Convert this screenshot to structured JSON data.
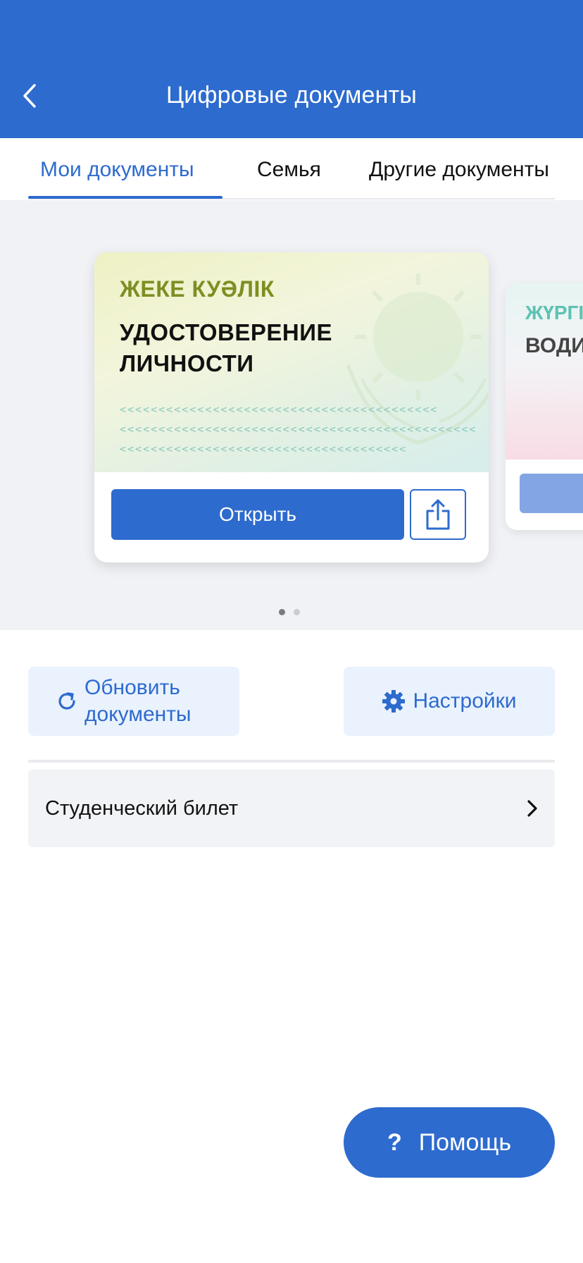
{
  "header": {
    "title": "Цифровые документы",
    "back_icon": "chevron-left-icon"
  },
  "tabs": [
    {
      "label": "Мои документы",
      "active": true
    },
    {
      "label": "Семья",
      "active": false
    },
    {
      "label": "Другие документы",
      "active": false
    }
  ],
  "carousel": {
    "cards": [
      {
        "title_kz": "ЖЕКЕ КУӘЛІК",
        "title_ru": "УДОСТОВЕРЕНИЕ ЛИЧНОСТИ",
        "mrz": [
          "<<<<<<<<<<<<<<<<<<<<<<<<<<<<<<<<<<<<<<<<<",
          "<<<<<<<<<<<<<<<<<<<<<<<<<<<<<<<<<<<<<<<<<<<<<<",
          "<<<<<<<<<<<<<<<<<<<<<<<<<<<<<<<<<<<<<"
        ],
        "open_label": "Открыть",
        "share_icon": "share-icon"
      },
      {
        "title_kz": "ЖҮРГІ",
        "title_ru": "ВОДИТ"
      }
    ],
    "page_count": 2,
    "current_page": 1
  },
  "actions": {
    "refresh_label_line1": "Обновить",
    "refresh_label_line2": "документы",
    "refresh_icon": "refresh-icon",
    "settings_label": "Настройки",
    "settings_icon": "gear-icon"
  },
  "list": [
    {
      "label": "Студенческий билет",
      "icon": "chevron-right-icon"
    }
  ],
  "help": {
    "label": "Помощь",
    "icon": "question-mark"
  },
  "colors": {
    "primary": "#2D6BCE",
    "light_bg": "#F1F2F6",
    "kz_title": "#7E8F22"
  }
}
